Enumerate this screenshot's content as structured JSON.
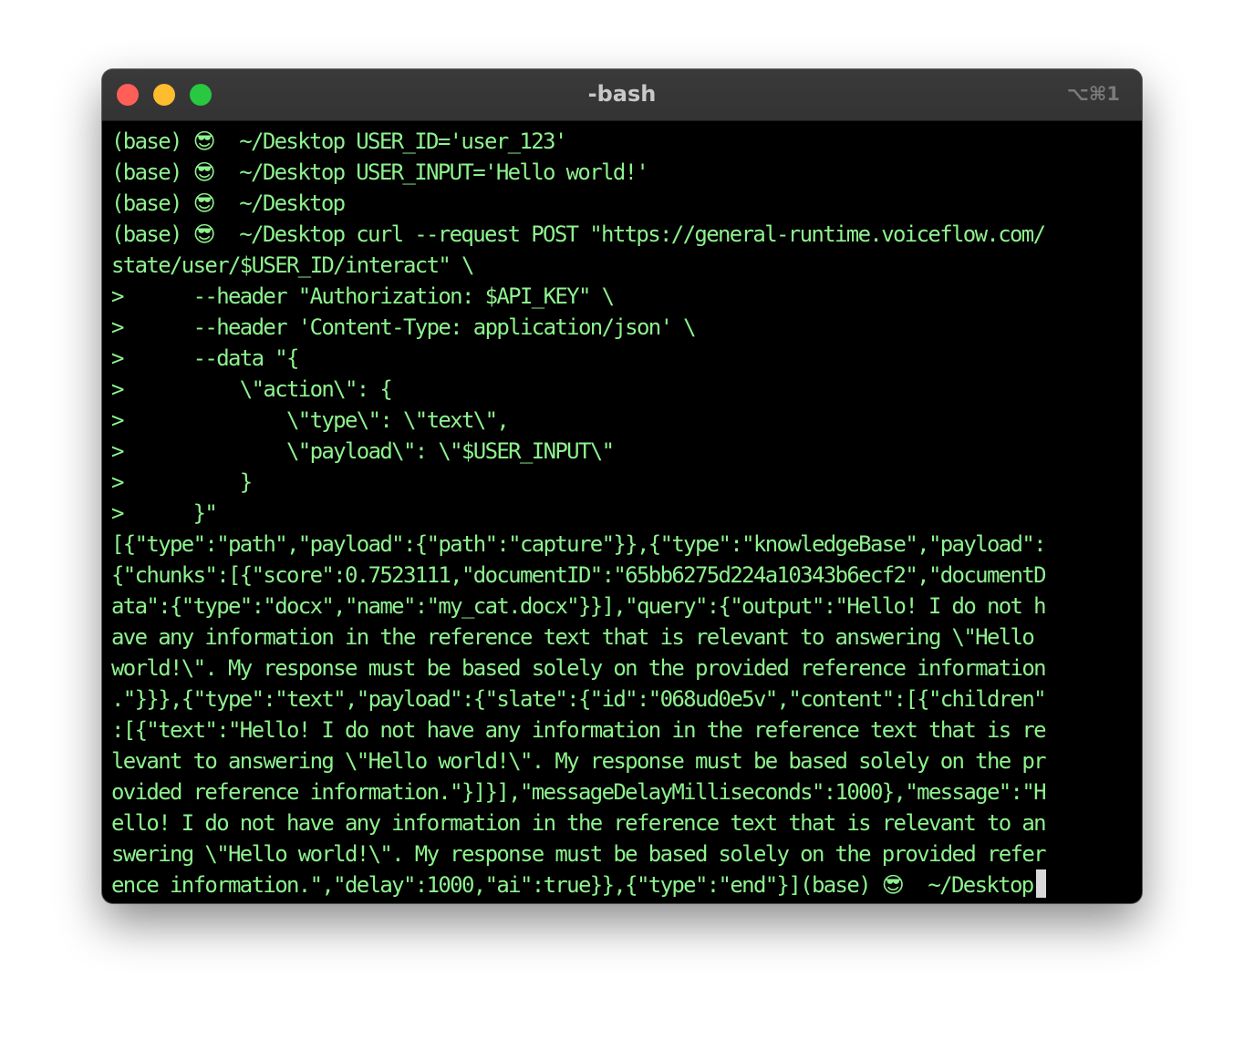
{
  "window": {
    "title": "-bash",
    "shortcut": "⌥⌘1"
  },
  "terminal": {
    "lines": [
      "(base) 😎  ~/Desktop USER_ID='user_123'",
      "(base) 😎  ~/Desktop USER_INPUT='Hello world!'",
      "(base) 😎  ~/Desktop",
      "(base) 😎  ~/Desktop curl --request POST \"https://general-runtime.voiceflow.com/",
      "state/user/$USER_ID/interact\" \\",
      ">      --header \"Authorization: $API_KEY\" \\",
      ">      --header 'Content-Type: application/json' \\",
      ">      --data \"{",
      ">          \\\"action\\\": {",
      ">              \\\"type\\\": \\\"text\\\",",
      ">              \\\"payload\\\": \\\"$USER_INPUT\\\"",
      ">          }",
      ">      }\"",
      "[{\"type\":\"path\",\"payload\":{\"path\":\"capture\"}},{\"type\":\"knowledgeBase\",\"payload\":",
      "{\"chunks\":[{\"score\":0.7523111,\"documentID\":\"65bb6275d224a10343b6ecf2\",\"documentD",
      "ata\":{\"type\":\"docx\",\"name\":\"my_cat.docx\"}}],\"query\":{\"output\":\"Hello! I do not h",
      "ave any information in the reference text that is relevant to answering \\\"Hello",
      "world!\\\". My response must be based solely on the provided reference information",
      ".\"}}},{\"type\":\"text\",\"payload\":{\"slate\":{\"id\":\"068ud0e5v\",\"content\":[{\"children\"",
      ":[{\"text\":\"Hello! I do not have any information in the reference text that is re",
      "levant to answering \\\"Hello world!\\\". My response must be based solely on the pr",
      "ovided reference information.\"}]}],\"messageDelayMilliseconds\":1000},\"message\":\"H",
      "ello! I do not have any information in the reference text that is relevant to an",
      "swering \\\"Hello world!\\\". My response must be based solely on the provided refer",
      "ence information.\",\"delay\":1000,\"ai\":true}},{\"type\":\"end\"}](base) 😎  ~/Desktop"
    ]
  }
}
